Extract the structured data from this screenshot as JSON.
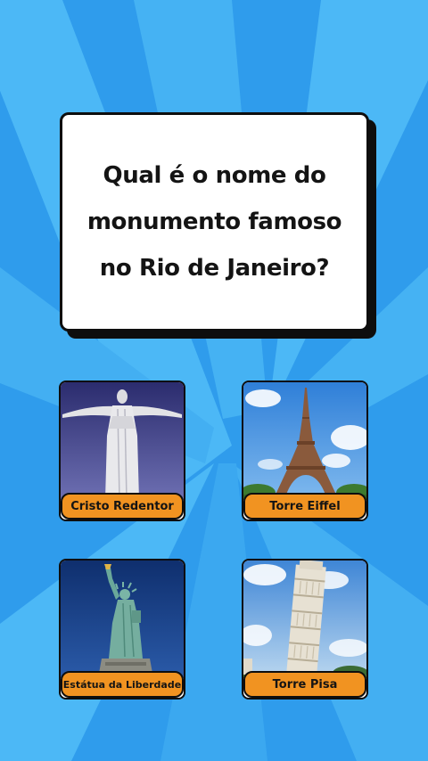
{
  "background": {
    "color": "#2f9cec",
    "ray_color": "#4cb8f6"
  },
  "question": {
    "lines": [
      "Qual é o nome do",
      "monumento famoso",
      "no Rio de Janeiro?"
    ]
  },
  "options": [
    {
      "label": "Cristo Redentor",
      "image": "christ-the-redeemer"
    },
    {
      "label": "Torre Eiffel",
      "image": "eiffel-tower"
    },
    {
      "label": "Estátua da Liberdade",
      "image": "statue-of-liberty"
    },
    {
      "label": "Torre Pisa",
      "image": "leaning-tower-of-pisa"
    }
  ],
  "colors": {
    "label_bg": "#f19321",
    "border": "#0e0e0e",
    "card_bg": "#ffffff"
  }
}
